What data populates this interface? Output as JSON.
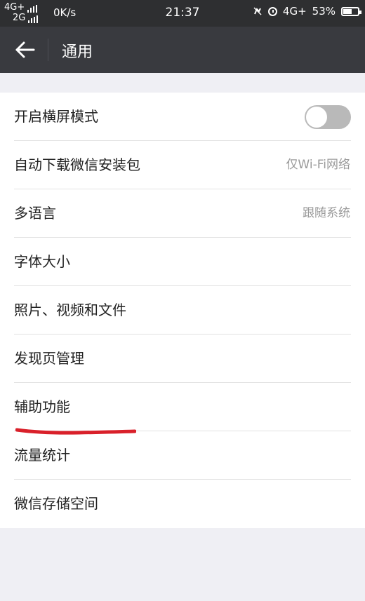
{
  "status_bar": {
    "network_top": "4G+",
    "network_bottom": "2G",
    "speed": "0K/s",
    "time": "21:37",
    "network_right": "4G+",
    "battery_percent": "53%",
    "battery_level": 0.53
  },
  "navbar": {
    "title": "通用",
    "back_icon": "arrow-left-icon"
  },
  "settings": {
    "items": [
      {
        "label": "开启横屏模式",
        "value": "",
        "toggle": false
      },
      {
        "label": "自动下载微信安装包",
        "value": "仅Wi-Fi网络"
      },
      {
        "label": "多语言",
        "value": "跟随系统"
      },
      {
        "label": "字体大小",
        "value": ""
      },
      {
        "label": "照片、视频和文件",
        "value": ""
      },
      {
        "label": "发现页管理",
        "value": ""
      },
      {
        "label": "辅助功能",
        "value": ""
      },
      {
        "label": "流量统计",
        "value": ""
      },
      {
        "label": "微信存储空间",
        "value": ""
      }
    ]
  },
  "colors": {
    "status_bar_bg": "#2e2f31",
    "navbar_bg": "#393a3f",
    "page_bg": "#efeff4",
    "toggle_off": "#b9b9b9",
    "annotation_red": "#d9202a"
  }
}
